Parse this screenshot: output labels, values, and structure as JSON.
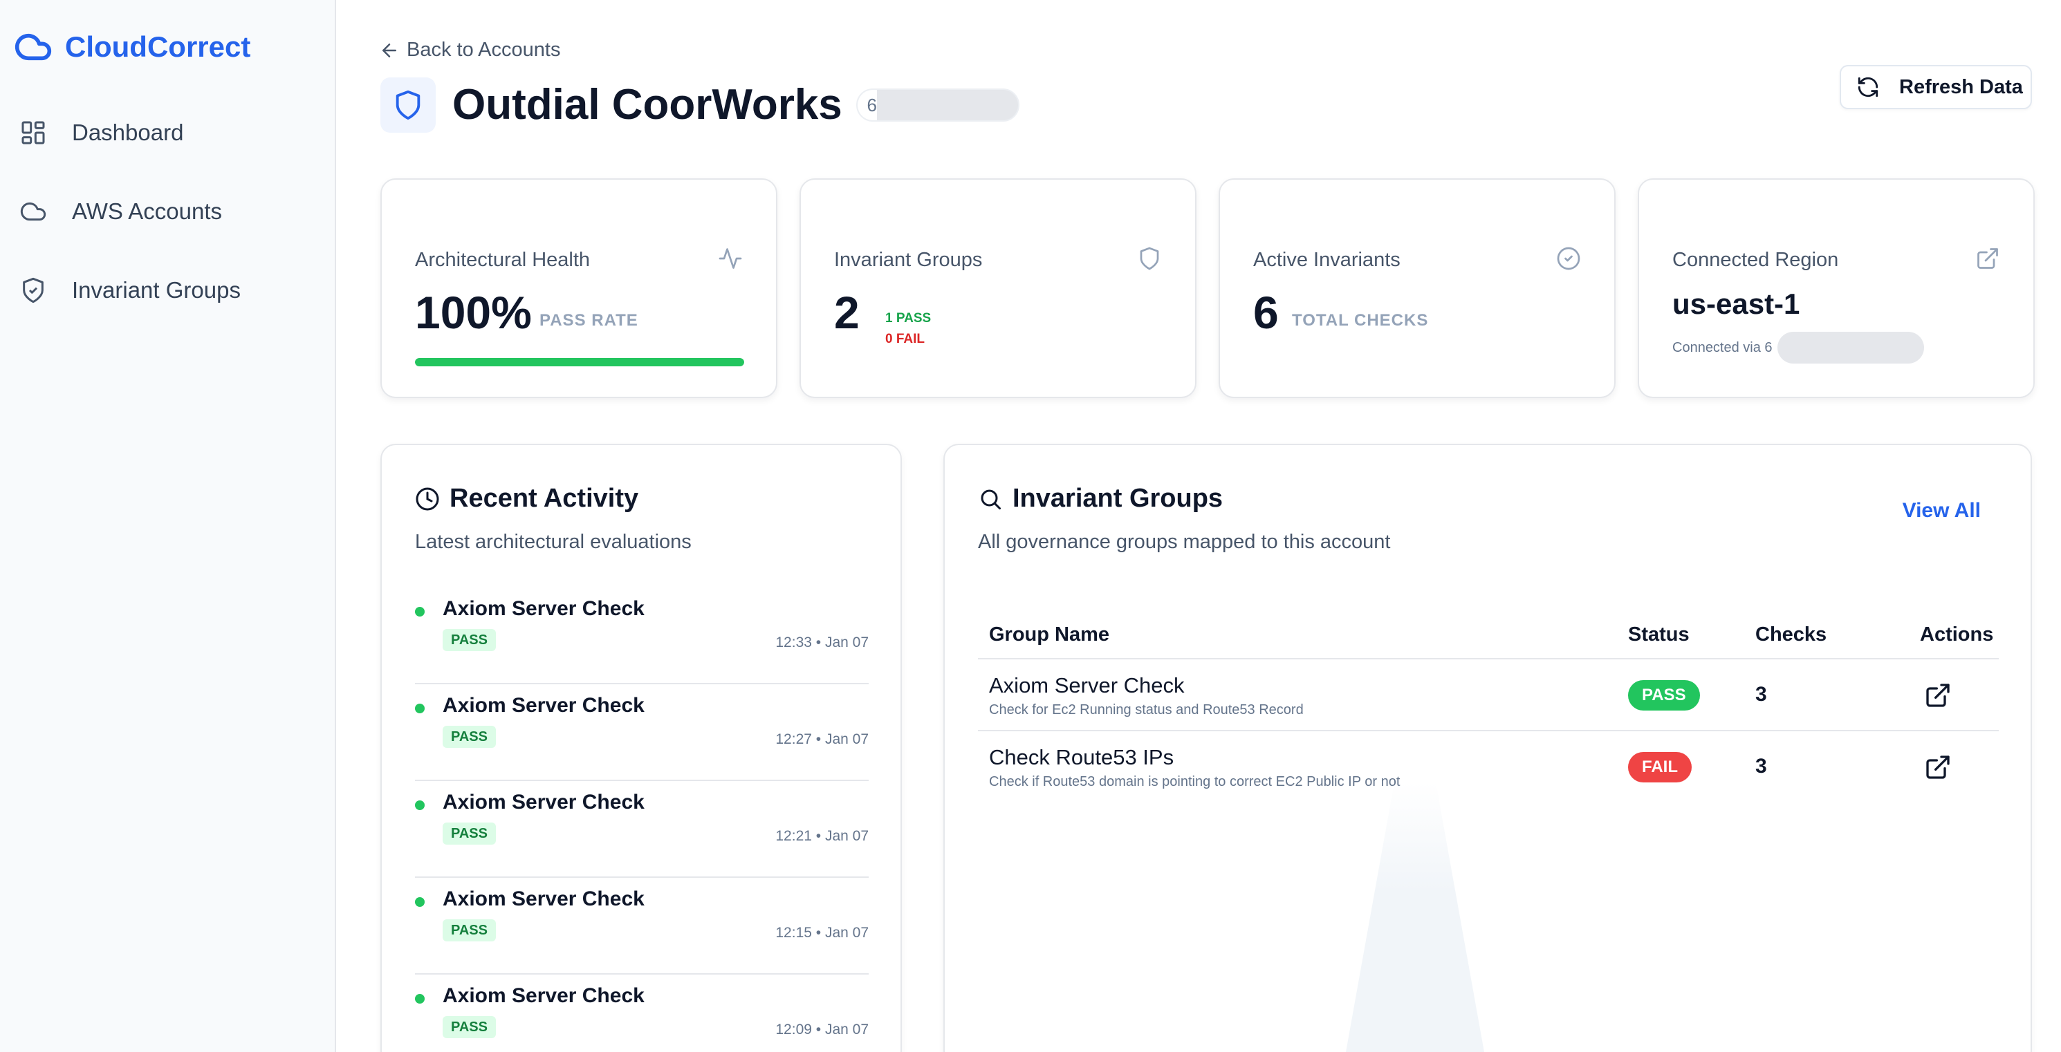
{
  "brand": {
    "name": "CloudCorrect",
    "color": "#2563eb"
  },
  "sidebar": {
    "items": [
      {
        "label": "Dashboard",
        "icon": "dashboard-grid-icon"
      },
      {
        "label": "AWS Accounts",
        "icon": "cloud-icon"
      },
      {
        "label": "Invariant Groups",
        "icon": "shield-check-icon"
      }
    ]
  },
  "header": {
    "back_label": "Back to Accounts",
    "title": "Outdial CoorWorks",
    "account_id_prefix": "6",
    "refresh_label": "Refresh Data"
  },
  "stats": {
    "health": {
      "caption": "Architectural Health",
      "value": "100%",
      "unit": "PASS RATE",
      "progress": 1.0,
      "icon": "activity-pulse-icon"
    },
    "groups": {
      "caption": "Invariant Groups",
      "value": "2",
      "pass": "1 PASS",
      "fail": "0 FAIL",
      "icon": "shield-icon"
    },
    "invariants": {
      "caption": "Active Invariants",
      "value": "6",
      "unit": "TOTAL CHECKS",
      "icon": "check-circle-icon"
    },
    "region": {
      "caption": "Connected Region",
      "value": "us-east-1",
      "connected_via": "Connected via 6",
      "icon": "external-link-icon"
    }
  },
  "recent": {
    "title": "Recent Activity",
    "subtitle": "Latest architectural evaluations",
    "items": [
      {
        "name": "Axiom Server Check",
        "status": "PASS",
        "time": "12:33 • Jan 07"
      },
      {
        "name": "Axiom Server Check",
        "status": "PASS",
        "time": "12:27 • Jan 07"
      },
      {
        "name": "Axiom Server Check",
        "status": "PASS",
        "time": "12:21 • Jan 07"
      },
      {
        "name": "Axiom Server Check",
        "status": "PASS",
        "time": "12:15 • Jan 07"
      },
      {
        "name": "Axiom Server Check",
        "status": "PASS",
        "time": "12:09 • Jan 07"
      }
    ]
  },
  "groups_panel": {
    "title": "Invariant Groups",
    "subtitle": "All governance groups mapped to this account",
    "view_all": "View All",
    "columns": [
      "Group Name",
      "Status",
      "Checks",
      "Actions"
    ],
    "rows": [
      {
        "name": "Axiom Server Check",
        "desc": "Check for Ec2 Running status and Route53 Record",
        "status": "PASS",
        "status_color": "#22c55e",
        "checks": "3"
      },
      {
        "name": "Check Route53 IPs",
        "desc": "Check if Route53 domain is pointing to correct EC2 Public IP or not",
        "status": "FAIL",
        "status_color": "#ef4444",
        "checks": "3"
      }
    ]
  }
}
